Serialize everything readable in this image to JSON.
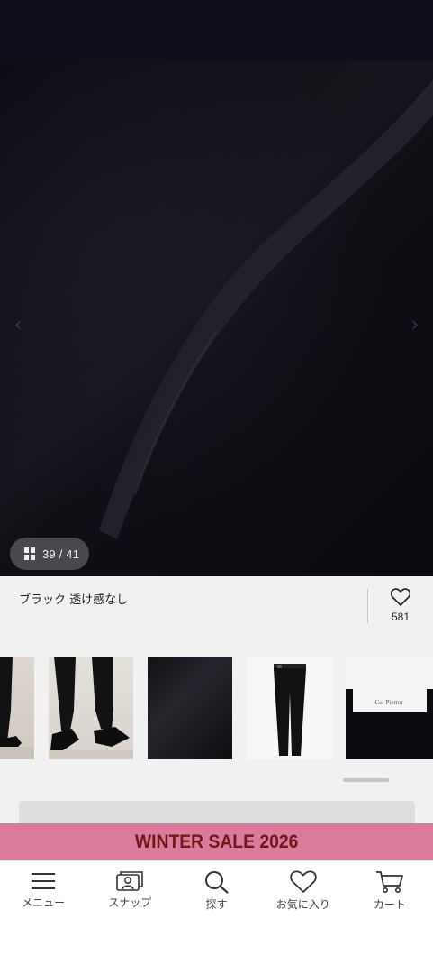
{
  "gallery": {
    "counter": "39 / 41"
  },
  "product": {
    "color_label": "ブラック 透け感なし",
    "favorite_count": "581"
  },
  "thumbnails": [
    {
      "name": "thumb-legs-heels-1"
    },
    {
      "name": "thumb-legs-heels-2"
    },
    {
      "name": "thumb-fabric-closeup"
    },
    {
      "name": "thumb-pants-flat"
    },
    {
      "name": "thumb-label-tag",
      "tag_text": "Col Pierrot"
    }
  ],
  "banner": {
    "text": "WINTER SALE 2026",
    "bg_color": "#dc7a9b",
    "text_color": "#6e1a1a"
  },
  "bottom_nav": [
    {
      "label": "メニュー",
      "icon": "menu-icon"
    },
    {
      "label": "スナップ",
      "icon": "snap-icon"
    },
    {
      "label": "探す",
      "icon": "search-icon"
    },
    {
      "label": "お気に入り",
      "icon": "heart-icon"
    },
    {
      "label": "カート",
      "icon": "cart-icon"
    }
  ]
}
